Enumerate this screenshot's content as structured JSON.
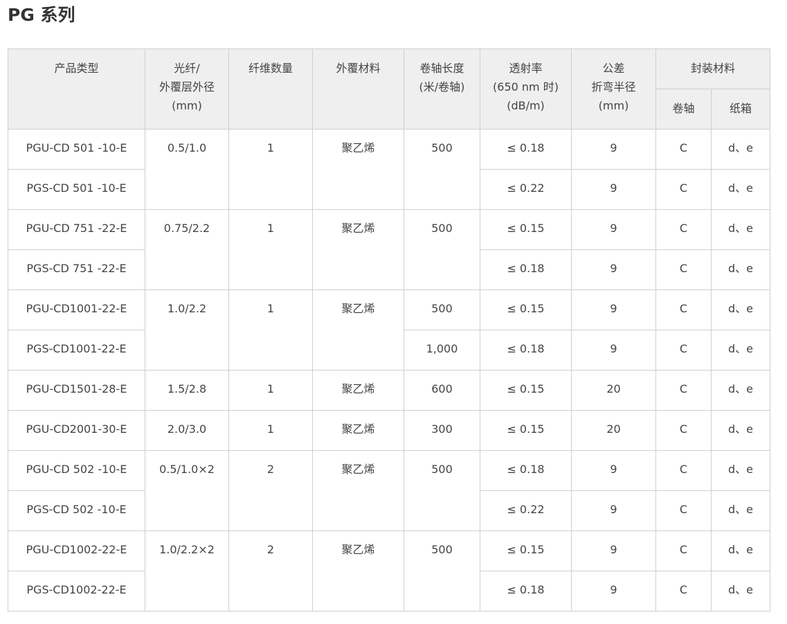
{
  "page": {
    "title": "PG 系列"
  },
  "table": {
    "headers": {
      "product_type": "产品类型",
      "fiber_line1": "光纤/",
      "fiber_line2": "外覆层外径",
      "fiber_line3": "(mm)",
      "fiber_count": "纤维数量",
      "jacket_material": "外覆材料",
      "reel_length_line1": "卷轴长度",
      "reel_length_line2": "(米/卷轴)",
      "transmittance_line1": "透射率",
      "transmittance_line2": "(650 nm 时)",
      "transmittance_line3": "(dB/m)",
      "bend_line1": "公差",
      "bend_line2": "折弯半径",
      "bend_line3": "(mm)",
      "packaging": "封装材料",
      "packaging_reel": "卷轴",
      "packaging_box": "纸箱"
    },
    "groups": [
      {
        "diameter": "0.5/1.0",
        "count": "1",
        "material": "聚乙烯",
        "rows": [
          {
            "product": "PGU-CD 501 -10-E",
            "length": "500",
            "transmittance": "≤ 0.18",
            "bend": "9",
            "reel": "C",
            "box": "d、e"
          },
          {
            "product": "PGS-CD 501 -10-E",
            "length": "",
            "transmittance": "≤ 0.22",
            "bend": "9",
            "reel": "C",
            "box": "d、e"
          }
        ]
      },
      {
        "diameter": "0.75/2.2",
        "count": "1",
        "material": "聚乙烯",
        "rows": [
          {
            "product": "PGU-CD 751 -22-E",
            "length": "500",
            "transmittance": "≤ 0.15",
            "bend": "9",
            "reel": "C",
            "box": "d、e"
          },
          {
            "product": "PGS-CD 751 -22-E",
            "length": "",
            "transmittance": "≤ 0.18",
            "bend": "9",
            "reel": "C",
            "box": "d、e"
          }
        ]
      },
      {
        "diameter": "1.0/2.2",
        "count": "1",
        "material": "聚乙烯",
        "rows": [
          {
            "product": "PGU-CD1001-22-E",
            "length": "500",
            "transmittance": "≤ 0.15",
            "bend": "9",
            "reel": "C",
            "box": "d、e"
          },
          {
            "product": "PGS-CD1001-22-E",
            "length": "1,000",
            "transmittance": "≤ 0.18",
            "bend": "9",
            "reel": "C",
            "box": "d、e"
          }
        ]
      },
      {
        "diameter": "1.5/2.8",
        "count": "1",
        "material": "聚乙烯",
        "rows": [
          {
            "product": "PGU-CD1501-28-E",
            "length": "600",
            "transmittance": "≤ 0.15",
            "bend": "20",
            "reel": "C",
            "box": "d、e"
          }
        ]
      },
      {
        "diameter": "2.0/3.0",
        "count": "1",
        "material": "聚乙烯",
        "rows": [
          {
            "product": "PGU-CD2001-30-E",
            "length": "300",
            "transmittance": "≤ 0.15",
            "bend": "20",
            "reel": "C",
            "box": "d、e"
          }
        ]
      },
      {
        "diameter": "0.5/1.0×2",
        "count": "2",
        "material": "聚乙烯",
        "rows": [
          {
            "product": "PGU-CD 502 -10-E",
            "length": "500",
            "transmittance": "≤ 0.18",
            "bend": "9",
            "reel": "C",
            "box": "d、e"
          },
          {
            "product": "PGS-CD 502 -10-E",
            "length": "",
            "transmittance": "≤ 0.22",
            "bend": "9",
            "reel": "C",
            "box": "d、e"
          }
        ]
      },
      {
        "diameter": "1.0/2.2×2",
        "count": "2",
        "material": "聚乙烯",
        "rows": [
          {
            "product": "PGU-CD1002-22-E",
            "length": "500",
            "transmittance": "≤ 0.15",
            "bend": "9",
            "reel": "C",
            "box": "d、e"
          },
          {
            "product": "PGS-CD1002-22-E",
            "length": "",
            "transmittance": "≤ 0.18",
            "bend": "9",
            "reel": "C",
            "box": "d、e"
          }
        ]
      }
    ]
  }
}
